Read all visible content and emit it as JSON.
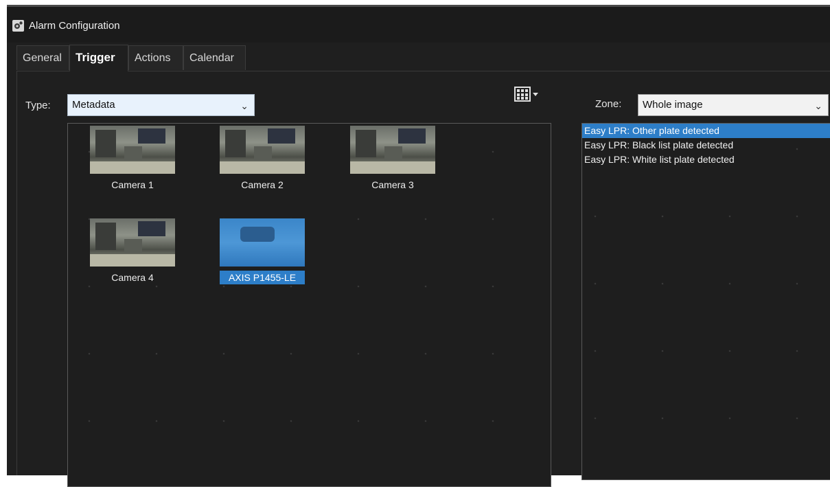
{
  "window": {
    "title": "Alarm Configuration"
  },
  "tabs": [
    {
      "label": "General"
    },
    {
      "label": "Trigger"
    },
    {
      "label": "Actions"
    },
    {
      "label": "Calendar"
    }
  ],
  "active_tab": "Trigger",
  "type": {
    "label": "Type:",
    "value": "Metadata"
  },
  "zone": {
    "label": "Zone:",
    "value": "Whole image"
  },
  "cameras": [
    {
      "name": "Camera 1",
      "selected": false
    },
    {
      "name": "Camera 2",
      "selected": false
    },
    {
      "name": "Camera 3",
      "selected": false
    },
    {
      "name": "Camera 4",
      "selected": false
    },
    {
      "name": "AXIS P1455-LE",
      "selected": true
    }
  ],
  "events": [
    {
      "label": "Easy LPR: Other plate detected",
      "selected": true
    },
    {
      "label": "Easy LPR: Black list plate detected",
      "selected": false
    },
    {
      "label": "Easy LPR: White list plate detected",
      "selected": false
    }
  ],
  "icons": {
    "title": "gear-icon",
    "grid": "grid-view-icon",
    "dropdown": "chevron-down-icon"
  },
  "colors": {
    "selection": "#2d7ec8",
    "background": "#1f1f1f",
    "combo_type_bg": "#e8f2fc",
    "combo_zone_bg": "#f2f2f2"
  }
}
